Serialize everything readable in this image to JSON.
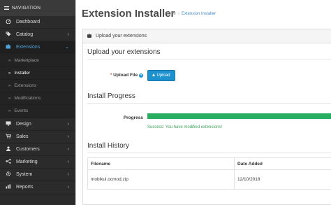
{
  "sidebar": {
    "header": "NAVIGATION",
    "items": [
      {
        "label": "Dashboard",
        "icon": "dashboard-icon",
        "has_children": false
      },
      {
        "label": "Catalog",
        "icon": "tag-icon",
        "has_children": true
      },
      {
        "label": "Extensions",
        "icon": "puzzle-icon",
        "has_children": true,
        "active": true
      },
      {
        "label": "Design",
        "icon": "monitor-icon",
        "has_children": true
      },
      {
        "label": "Sales",
        "icon": "cart-icon",
        "has_children": true
      },
      {
        "label": "Customers",
        "icon": "user-icon",
        "has_children": true
      },
      {
        "label": "Marketing",
        "icon": "share-icon",
        "has_children": true
      },
      {
        "label": "System",
        "icon": "cog-icon",
        "has_children": true
      },
      {
        "label": "Reports",
        "icon": "bar-chart-icon",
        "has_children": true
      }
    ],
    "extensions_submenu": [
      {
        "label": "Marketplace"
      },
      {
        "label": "Installer",
        "active": true
      },
      {
        "label": "Extensions"
      },
      {
        "label": "Modifications"
      },
      {
        "label": "Events"
      }
    ]
  },
  "header": {
    "title": "Extension Installer",
    "breadcrumb": [
      "Home",
      "Extension Installer"
    ]
  },
  "panel": {
    "heading": "Upload your extensions",
    "upload_section_title": "Upload your extensions",
    "upload_label": "Upload File",
    "required_mark": "*",
    "help_glyph": "?",
    "upload_button_label": "Upload",
    "progress_section_title": "Install Progress",
    "progress_label": "Progress",
    "progress_percent": 100,
    "progress_color": "#27ae60",
    "success_message": "Success: You have modified extensions!",
    "history_section_title": "Install History",
    "history_columns": [
      "Filename",
      "Date Added"
    ],
    "history_rows": [
      {
        "filename": "mobikul.ocmod.zip",
        "date_added": "12/10/2018"
      }
    ]
  },
  "colors": {
    "sidebar_bg": "#2b2b2b",
    "accent": "#1e91cf",
    "active_link": "#4fa3db",
    "success": "#3aa65c"
  }
}
